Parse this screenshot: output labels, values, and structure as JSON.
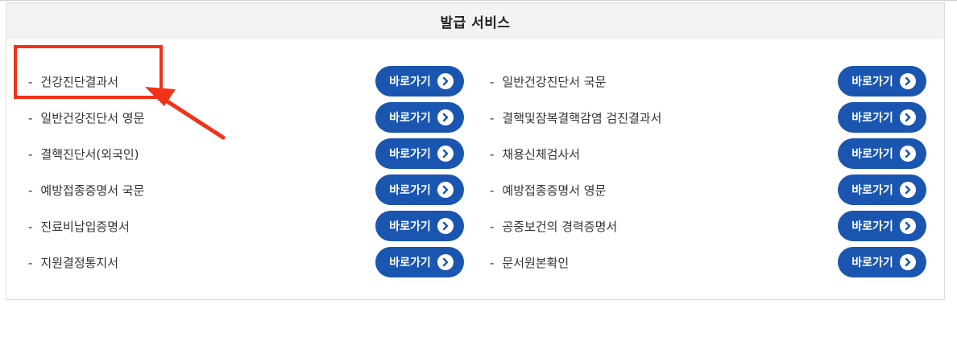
{
  "panel": {
    "title": "발급 서비스",
    "button_label": "바로가기",
    "dash": "-",
    "left_items": [
      {
        "label": "건강진단결과서"
      },
      {
        "label": "일반건강진단서 영문"
      },
      {
        "label": "결핵진단서(외국인)"
      },
      {
        "label": "예방접종증명서 국문"
      },
      {
        "label": "진료비납입증명서"
      },
      {
        "label": "지원결정통지서"
      }
    ],
    "right_items": [
      {
        "label": "일반건강진단서 국문"
      },
      {
        "label": "결핵및잠복결핵감염 검진결과서"
      },
      {
        "label": "채용신체검사서"
      },
      {
        "label": "예방접종증명서 영문"
      },
      {
        "label": "공중보건의 경력증명서"
      },
      {
        "label": "문서원본확인"
      }
    ]
  },
  "colors": {
    "button_bg": "#1a56b0",
    "highlight": "#f0331a",
    "header_bg": "#f3f3f3"
  },
  "icons": {
    "button_icon": "chevron-right-circle-icon",
    "annotation": "red-arrow-icon"
  }
}
